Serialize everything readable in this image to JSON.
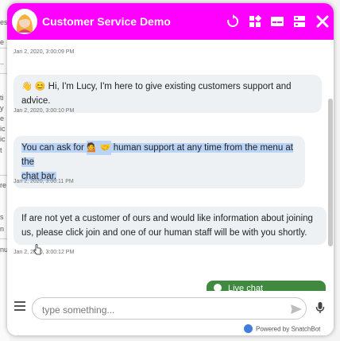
{
  "background_page": {
    "fragments": [
      "es",
      "e",
      "..",
      "ti",
      "y",
      "e",
      "ic",
      "ic",
      "t",
      "re",
      "s",
      "n",
      "nu"
    ]
  },
  "header": {
    "title": "Customer Service Demo",
    "color": "#ff00ff",
    "icons": [
      "refresh-icon",
      "grid-menu-icon",
      "card-icon",
      "layout-icon",
      "close-icon"
    ]
  },
  "messages": [
    {
      "timestamp": "Jan 2, 2020, 3:00:09 PM",
      "emoji": "👋 😊",
      "text": "Hi, I'm Lucy, I'm here to give existing customers support and advice."
    },
    {
      "timestamp": "Jan 2, 2020, 3:00:10 PM",
      "line1_a": "You can ask for",
      "emoji": "💁 🤝",
      "line1_b": "human support at any time from the menu at the",
      "line2": "chat bar."
    },
    {
      "timestamp": "Jan 2, 2020, 3:00:11 PM",
      "line1": "If are not yet a customer of ours and would like information about joining",
      "line2": "us, please click join and one of our human staff will be with you shortly."
    },
    {
      "timestamp": "Jan 2, 2020, 3:00:12 PM"
    }
  ],
  "live_chat": {
    "label": "Live chat",
    "color": "#3f8a3f"
  },
  "composer": {
    "placeholder": "type something...",
    "value": ""
  },
  "footer": {
    "powered_by": "Powered by SnatchBot"
  }
}
